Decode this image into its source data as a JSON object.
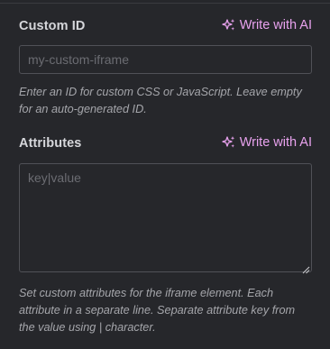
{
  "custom_id": {
    "label": "Custom ID",
    "ai_button_label": "Write with AI",
    "placeholder": "my-custom-iframe",
    "value": "",
    "help": "Enter an ID for custom CSS or JavaScript. Leave empty for an auto-generated ID."
  },
  "attributes": {
    "label": "Attributes",
    "ai_button_label": "Write with AI",
    "placeholder": "key|value",
    "value": "",
    "help": "Set custom attributes for the iframe element. Each attribute in a separate line. Separate attribute key from the value using | character."
  },
  "colors": {
    "background": "#26272b",
    "label": "#d6d7db",
    "ai_accent": "#e8a2ee",
    "border": "#505157",
    "help_text": "#a5a6ab",
    "placeholder": "#6b6c72"
  },
  "icons": {
    "ai": "sparkle-icon",
    "resize": "resize-handle-icon"
  }
}
